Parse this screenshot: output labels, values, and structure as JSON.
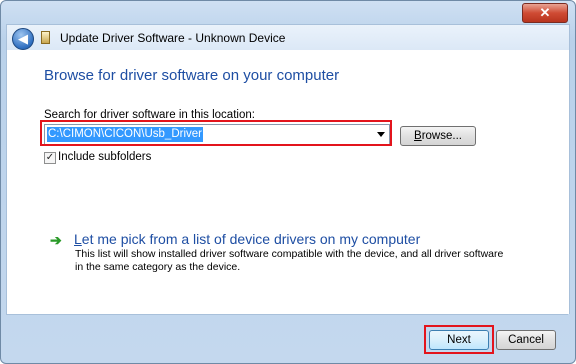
{
  "window": {
    "title": "Update Driver Software - Unknown Device",
    "close_label": "✕"
  },
  "page": {
    "heading": "Browse for driver software on your computer",
    "search_label": "Search for driver software in this location:",
    "path_value": "C:\\CIMON\\CICON\\Usb_Driver",
    "browse_label_main": "rowse...",
    "browse_label_key": "B",
    "include_subfolders": "Include subfolders",
    "include_subfolders_checked": true,
    "pick_link_key": "L",
    "pick_link_rest": "et me pick from a list of device drivers on my computer",
    "pick_description": "This list will show installed driver software compatible with the device, and all driver software in the same category as the device."
  },
  "footer": {
    "next_label": "Next",
    "cancel_label": "Cancel"
  },
  "icons": {
    "back": "back-arrow-icon",
    "device": "device-icon",
    "pick": "green-arrow-icon"
  },
  "colors": {
    "heading": "#1e4ea3",
    "highlight": "#e3141c",
    "selection": "#3399ff"
  }
}
